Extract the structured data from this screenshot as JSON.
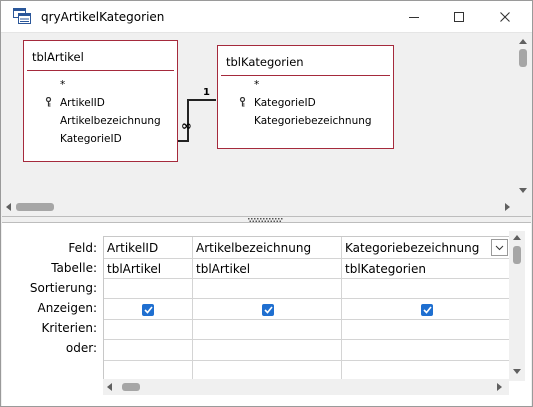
{
  "window": {
    "title": "qryArtikelKategorien",
    "icon": "query-icon",
    "controls": [
      "minimize-icon",
      "maximize-icon",
      "close-icon"
    ]
  },
  "tables": [
    {
      "name": "tblArtikel",
      "fields": [
        "*",
        "ArtikelID",
        "Artikelbezeichnung",
        "KategorieID"
      ],
      "primary_key": "ArtikelID"
    },
    {
      "name": "tblKategorien",
      "fields": [
        "*",
        "KategorieID",
        "Kategoriebezeichnung"
      ],
      "primary_key": "KategorieID"
    }
  ],
  "relationship": {
    "one_side": "1",
    "many_side": "∞"
  },
  "grid": {
    "row_labels": {
      "feld": "Feld:",
      "tabelle": "Tabelle:",
      "sortierung": "Sortierung:",
      "anzeigen": "Anzeigen:",
      "kriterien": "Kriterien:",
      "oder": "oder:"
    },
    "columns": [
      {
        "feld": "ArtikelID",
        "tabelle": "tblArtikel",
        "anzeigen": true
      },
      {
        "feld": "Artikelbezeichnung",
        "tabelle": "tblArtikel",
        "anzeigen": true
      },
      {
        "feld": "Kategoriebezeichnung",
        "tabelle": "tblKategorien",
        "anzeigen": true
      }
    ]
  }
}
